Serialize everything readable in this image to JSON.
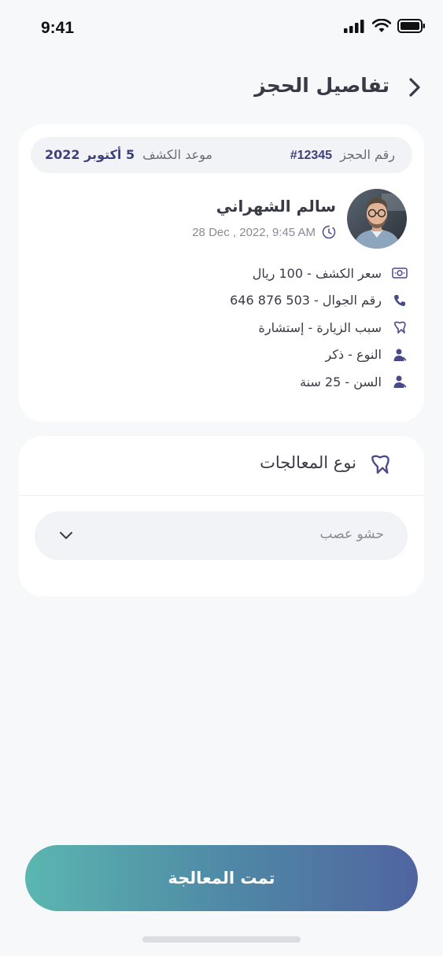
{
  "status_bar": {
    "time": "9:41"
  },
  "header": {
    "title": "تفاصيل الحجز"
  },
  "booking": {
    "number_label": "رقم الحجز",
    "number_value": "#12345",
    "date_label": "موعد الكشف",
    "date_value": "5 أكتوبر 2022"
  },
  "patient": {
    "name": "سالم الشهراني",
    "datetime": "28 Dec , 2022, 9:45 AM",
    "details": [
      {
        "icon": "money-icon",
        "text": "سعر الكشف - 100 ريال"
      },
      {
        "icon": "phone-icon",
        "text": "رقم الجوال -  503 876 646"
      },
      {
        "icon": "tooth-icon",
        "text": "سبب الزيارة - إستشارة"
      },
      {
        "icon": "person-icon",
        "text": "النوع - ذكر"
      },
      {
        "icon": "person-icon",
        "text": "السن - 25 سنة"
      }
    ]
  },
  "treatment": {
    "title": "نوع المعالجات",
    "selected": "حشو عصب"
  },
  "actions": {
    "done_label": "تمت المعالجة"
  },
  "colors": {
    "accent": "#3f3f7a",
    "button_gradient_start": "#5bb6b0",
    "button_gradient_end": "#5064a0"
  }
}
